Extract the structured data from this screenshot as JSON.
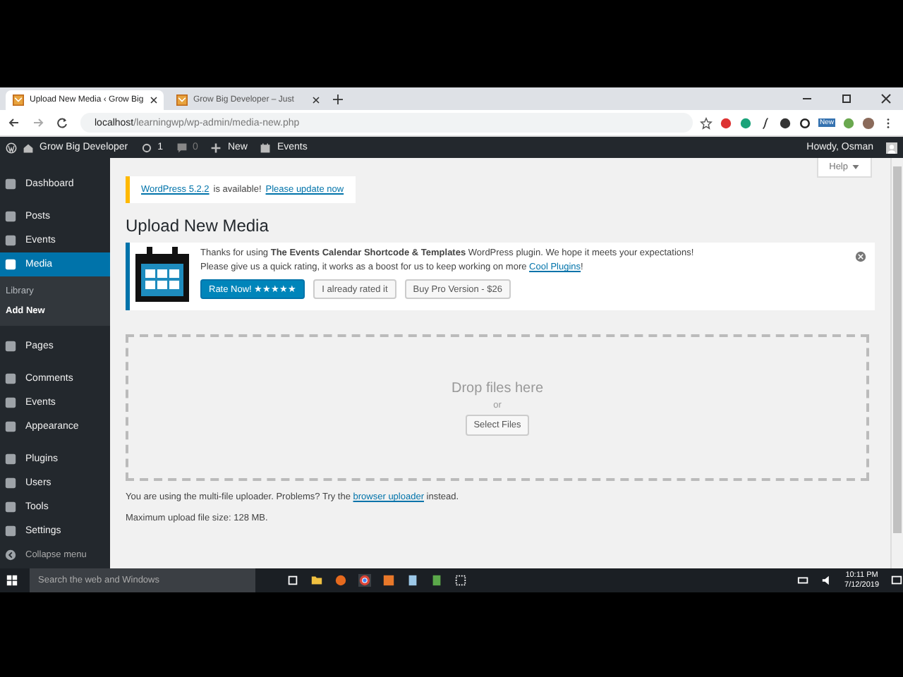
{
  "browser": {
    "tabs": [
      {
        "title": "Upload New Media ‹ Grow Big",
        "selected": true
      },
      {
        "title": "Grow Big Developer – Just",
        "selected": false
      }
    ],
    "url": {
      "host": "localhost",
      "path": "/learningwp/wp-admin/media-new.php"
    },
    "extension_badge": "New"
  },
  "admin_bar": {
    "site": "Grow Big Developer",
    "updates": "1",
    "comments": "0",
    "new": "New",
    "events": "Events",
    "greeting": "Howdy, Osman"
  },
  "sidebar": {
    "items": [
      {
        "label": "Dashboard",
        "selected": false
      },
      {
        "label": "Posts",
        "selected": false
      },
      {
        "label": "Events",
        "selected": false
      },
      {
        "label": "Media",
        "selected": true,
        "children": [
          {
            "label": "Library",
            "selected": false
          },
          {
            "label": "Add New",
            "selected": true
          }
        ]
      },
      {
        "label": "Pages",
        "selected": false
      },
      {
        "label": "Comments",
        "selected": false
      },
      {
        "label": "Events",
        "selected": false
      },
      {
        "label": "Appearance",
        "selected": false
      },
      {
        "label": "Plugins",
        "selected": false
      },
      {
        "label": "Users",
        "selected": false
      },
      {
        "label": "Tools",
        "selected": false
      },
      {
        "label": "Settings",
        "selected": false
      }
    ],
    "collapse": "Collapse menu"
  },
  "help_tab": "Help",
  "update_notice": {
    "version_link": "WordPress 5.2.2",
    "text": "is available!",
    "update_link": "Please update now"
  },
  "title": "Upload New Media",
  "plugin_notice": {
    "line_1": "Thanks for using **The Events Calendar Shortcode & Templates** WordPress plugin. We hope it meets your expectations!",
    "line_2_text": "Please give us a quick rating, it works as a boost for us to keep working on more",
    "line_2_link": "Cool Plugins",
    "line_2_end": "!",
    "buttons": [
      {
        "label": "Rate Now! ★★★★★",
        "kind": "primary"
      },
      {
        "label": "I already rated it",
        "kind": "secondary"
      },
      {
        "label": "Buy Pro Version - $26",
        "kind": "secondary"
      }
    ]
  },
  "drop_zone": {
    "heading": "Drop files here",
    "or": "or",
    "button": "Select Files"
  },
  "uploader_note": {
    "text": "You are using the multi-file uploader. Problems? Try the",
    "link": "browser uploader",
    "end": "instead."
  },
  "max_size": "Maximum upload file size: 128 MB.",
  "taskbar": {
    "search_placeholder": "Search the web and Windows",
    "time": "10:11 PM",
    "date": "7/12/2019"
  }
}
